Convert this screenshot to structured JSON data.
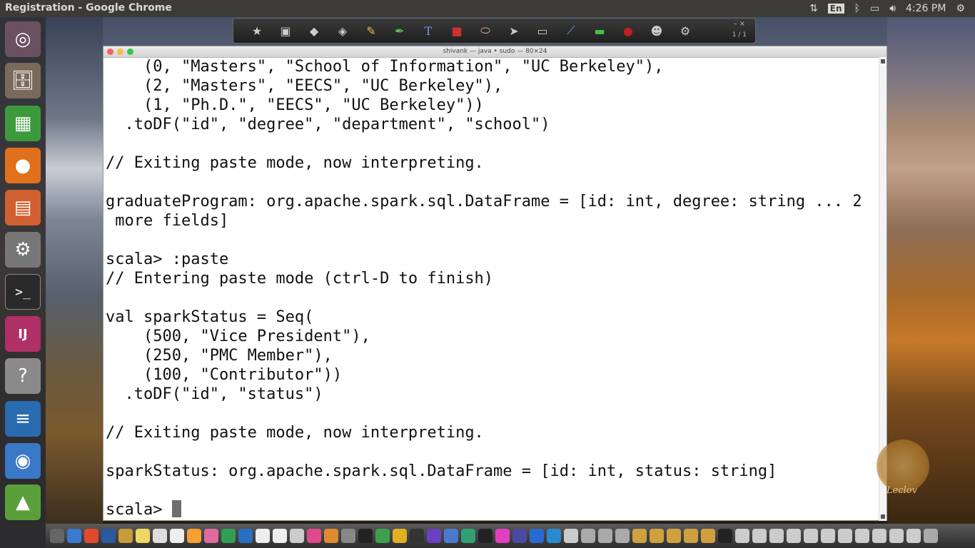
{
  "top_panel": {
    "window_title": "Registration - Google Chrome",
    "lang": "En",
    "clock": "4:26 PM"
  },
  "annotation_toolbar": {
    "pager": "1 / 1",
    "tools": [
      "star-icon",
      "camera-icon",
      "layers-icon",
      "folder-icon",
      "pencil-icon",
      "marker-icon",
      "text-tool-icon",
      "shapes-icon",
      "eraser-icon",
      "pointer-icon",
      "screen-icon",
      "brush-icon",
      "rectangle-icon",
      "record-icon",
      "user-icon",
      "gear-icon"
    ]
  },
  "terminal": {
    "title": "shivank — java • sudo — 80×24",
    "lines": [
      "    (0, \"Masters\", \"School of Information\", \"UC Berkeley\"),",
      "    (2, \"Masters\", \"EECS\", \"UC Berkeley\"),",
      "    (1, \"Ph.D.\", \"EECS\", \"UC Berkeley\"))",
      "  .toDF(\"id\", \"degree\", \"department\", \"school\")",
      "",
      "// Exiting paste mode, now interpreting.",
      "",
      "graduateProgram: org.apache.spark.sql.DataFrame = [id: int, degree: string ... 2",
      " more fields]",
      "",
      "scala> :paste",
      "// Entering paste mode (ctrl-D to finish)",
      "",
      "val sparkStatus = Seq(",
      "    (500, \"Vice President\"),",
      "    (250, \"PMC Member\"),",
      "    (100, \"Contributor\"))",
      "  .toDF(\"id\", \"status\")",
      "",
      "// Exiting paste mode, now interpreting.",
      "",
      "sparkStatus: org.apache.spark.sql.DataFrame = [id: int, status: string]",
      "",
      "scala> "
    ]
  },
  "launcher": {
    "items": [
      {
        "name": "ubuntu-logo-icon",
        "color": "#dd4814"
      },
      {
        "name": "files-icon",
        "color": "#6a5a4a"
      },
      {
        "name": "spreadsheet-icon",
        "color": "#3c9a3c"
      },
      {
        "name": "firefox-icon",
        "color": "#e76a1c"
      },
      {
        "name": "presentation-icon",
        "color": "#d35a2a"
      },
      {
        "name": "settings-icon",
        "color": "#7a7a7a"
      },
      {
        "name": "terminal-icon",
        "color": "#2c2c2c"
      },
      {
        "name": "intellij-icon",
        "color": "#c23a6a"
      },
      {
        "name": "help-icon",
        "color": "#8a8a8a"
      },
      {
        "name": "writer-icon",
        "color": "#2a6ab0"
      },
      {
        "name": "chrome-icon",
        "color": "#4a8ad4"
      },
      {
        "name": "image-viewer-icon",
        "color": "#5aa03a"
      },
      {
        "name": "disk-icon",
        "color": "#9a9a9a"
      }
    ]
  },
  "watermark": {
    "text": "Leclov"
  }
}
